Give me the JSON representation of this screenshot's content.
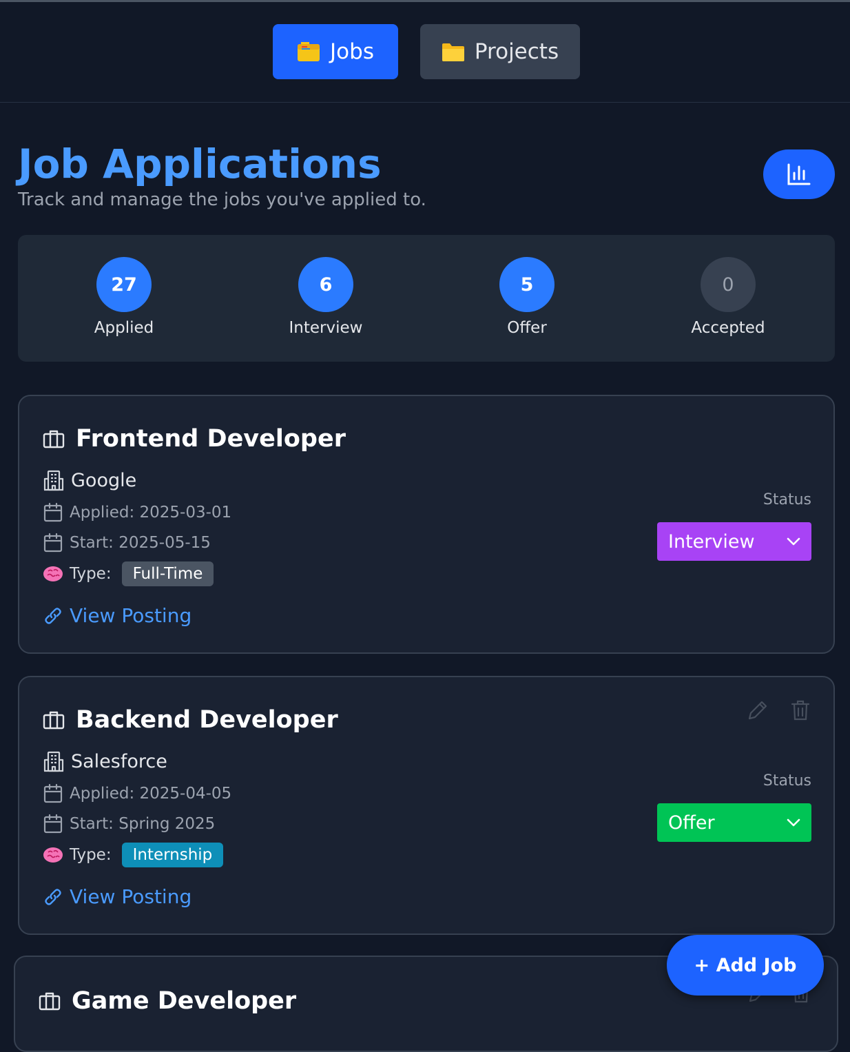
{
  "nav": {
    "tabs": [
      {
        "label": "Jobs",
        "icon": "card-index-icon",
        "active": true
      },
      {
        "label": "Projects",
        "icon": "folder-icon",
        "active": false
      }
    ]
  },
  "header": {
    "title": "Job Applications",
    "subtitle": "Track and manage the jobs you've applied to.",
    "stats_button_icon": "bar-chart-icon"
  },
  "summary": [
    {
      "count": "27",
      "label": "Applied"
    },
    {
      "count": "6",
      "label": "Interview"
    },
    {
      "count": "5",
      "label": "Offer"
    },
    {
      "count": "0",
      "label": "Accepted"
    }
  ],
  "jobs": [
    {
      "title": "Frontend Developer",
      "company": "Google",
      "applied": "Applied: 2025-03-01",
      "start": "Start: 2025-05-15",
      "type_label": "Type:",
      "type": "Full-Time",
      "link": "View Posting",
      "status_label": "Status",
      "status": "Interview",
      "status_color": "#a843f5"
    },
    {
      "title": "Backend Developer",
      "company": "Salesforce",
      "applied": "Applied: 2025-04-05",
      "start": "Start: Spring 2025",
      "type_label": "Type:",
      "type": "Internship",
      "link": "View Posting",
      "status_label": "Status",
      "status": "Offer",
      "status_color": "#00c455"
    },
    {
      "title": "Game Developer"
    }
  ],
  "fab": {
    "label": "+ Add Job"
  },
  "colors": {
    "accent": "#1d63ff",
    "title": "#4a9bff",
    "background": "#111827",
    "card": "#1a2232"
  }
}
